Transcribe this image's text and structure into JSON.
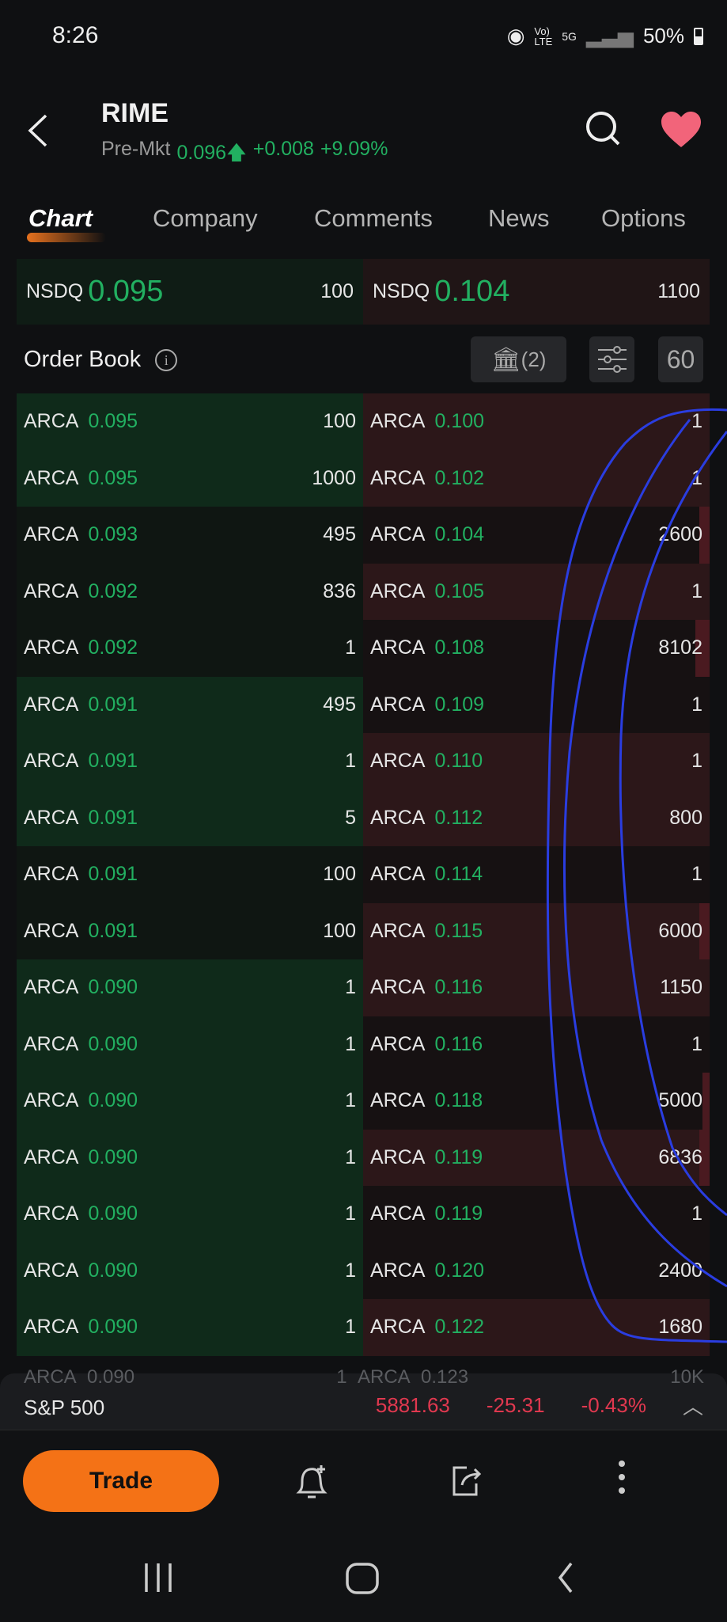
{
  "status_bar": {
    "time": "8:26",
    "icons": [
      "hotspot-icon",
      "volte-icon",
      "5g-icon",
      "signal-icon"
    ],
    "battery": "50%"
  },
  "header": {
    "symbol": "RIME",
    "session": "Pre-Mkt",
    "price": "0.096",
    "change": "+0.008",
    "change_pct": "+9.09%"
  },
  "tabs": [
    {
      "label": "Chart",
      "active": true
    },
    {
      "label": "Company"
    },
    {
      "label": "Comments"
    },
    {
      "label": "News"
    },
    {
      "label": "Options"
    }
  ],
  "nbbo": {
    "bid": {
      "exchange": "NSDQ",
      "price": "0.095",
      "size": "100"
    },
    "ask": {
      "exchange": "NSDQ",
      "price": "0.104",
      "size": "1100"
    }
  },
  "order_book": {
    "title": "Order Book",
    "exchanges_count": "(2)",
    "depth": "60"
  },
  "bids": [
    {
      "ex": "ARCA",
      "price": "0.095",
      "size": "100",
      "hl": true
    },
    {
      "ex": "ARCA",
      "price": "0.095",
      "size": "1000",
      "hl": true
    },
    {
      "ex": "ARCA",
      "price": "0.093",
      "size": "495",
      "hl": false
    },
    {
      "ex": "ARCA",
      "price": "0.092",
      "size": "836",
      "hl": false
    },
    {
      "ex": "ARCA",
      "price": "0.092",
      "size": "1",
      "hl": false
    },
    {
      "ex": "ARCA",
      "price": "0.091",
      "size": "495",
      "hl": true
    },
    {
      "ex": "ARCA",
      "price": "0.091",
      "size": "1",
      "hl": true
    },
    {
      "ex": "ARCA",
      "price": "0.091",
      "size": "5",
      "hl": true
    },
    {
      "ex": "ARCA",
      "price": "0.091",
      "size": "100",
      "hl": false
    },
    {
      "ex": "ARCA",
      "price": "0.091",
      "size": "100",
      "hl": false
    },
    {
      "ex": "ARCA",
      "price": "0.090",
      "size": "1",
      "hl": true
    },
    {
      "ex": "ARCA",
      "price": "0.090",
      "size": "1",
      "hl": true
    },
    {
      "ex": "ARCA",
      "price": "0.090",
      "size": "1",
      "hl": true
    },
    {
      "ex": "ARCA",
      "price": "0.090",
      "size": "1",
      "hl": true
    },
    {
      "ex": "ARCA",
      "price": "0.090",
      "size": "1",
      "hl": true
    },
    {
      "ex": "ARCA",
      "price": "0.090",
      "size": "1",
      "hl": true
    },
    {
      "ex": "ARCA",
      "price": "0.090",
      "size": "1",
      "hl": true
    }
  ],
  "asks": [
    {
      "ex": "ARCA",
      "price": "0.100",
      "size": "1",
      "hl": true
    },
    {
      "ex": "ARCA",
      "price": "0.102",
      "size": "1",
      "hl": true
    },
    {
      "ex": "ARCA",
      "price": "0.104",
      "size": "2600",
      "hl": false
    },
    {
      "ex": "ARCA",
      "price": "0.105",
      "size": "1",
      "hl": true
    },
    {
      "ex": "ARCA",
      "price": "0.108",
      "size": "8102",
      "hl": false
    },
    {
      "ex": "ARCA",
      "price": "0.109",
      "size": "1",
      "hl": false
    },
    {
      "ex": "ARCA",
      "price": "0.110",
      "size": "1",
      "hl": true
    },
    {
      "ex": "ARCA",
      "price": "0.112",
      "size": "800",
      "hl": true
    },
    {
      "ex": "ARCA",
      "price": "0.114",
      "size": "1",
      "hl": false
    },
    {
      "ex": "ARCA",
      "price": "0.115",
      "size": "6000",
      "hl": true
    },
    {
      "ex": "ARCA",
      "price": "0.116",
      "size": "1150",
      "hl": true
    },
    {
      "ex": "ARCA",
      "price": "0.116",
      "size": "1",
      "hl": false
    },
    {
      "ex": "ARCA",
      "price": "0.118",
      "size": "5000",
      "hl": false
    },
    {
      "ex": "ARCA",
      "price": "0.119",
      "size": "6836",
      "hl": true
    },
    {
      "ex": "ARCA",
      "price": "0.119",
      "size": "1",
      "hl": false
    },
    {
      "ex": "ARCA",
      "price": "0.120",
      "size": "2400",
      "hl": false
    },
    {
      "ex": "ARCA",
      "price": "0.122",
      "size": "1680",
      "hl": true
    }
  ],
  "partial_row": {
    "bid": {
      "ex": "ARCA",
      "price": "0.090",
      "size": "1"
    },
    "ask": {
      "ex": "ARCA",
      "price": "0.123",
      "size": "10K"
    }
  },
  "index_bar": {
    "name": "S&P 500",
    "value": "5881.63",
    "change": "-25.31",
    "change_pct": "-0.43%"
  },
  "actions": {
    "trade_label": "Trade"
  },
  "colors": {
    "up": "#22b061",
    "down": "#e0384f",
    "accent": "#f47216",
    "annotation": "#2a3de0"
  }
}
